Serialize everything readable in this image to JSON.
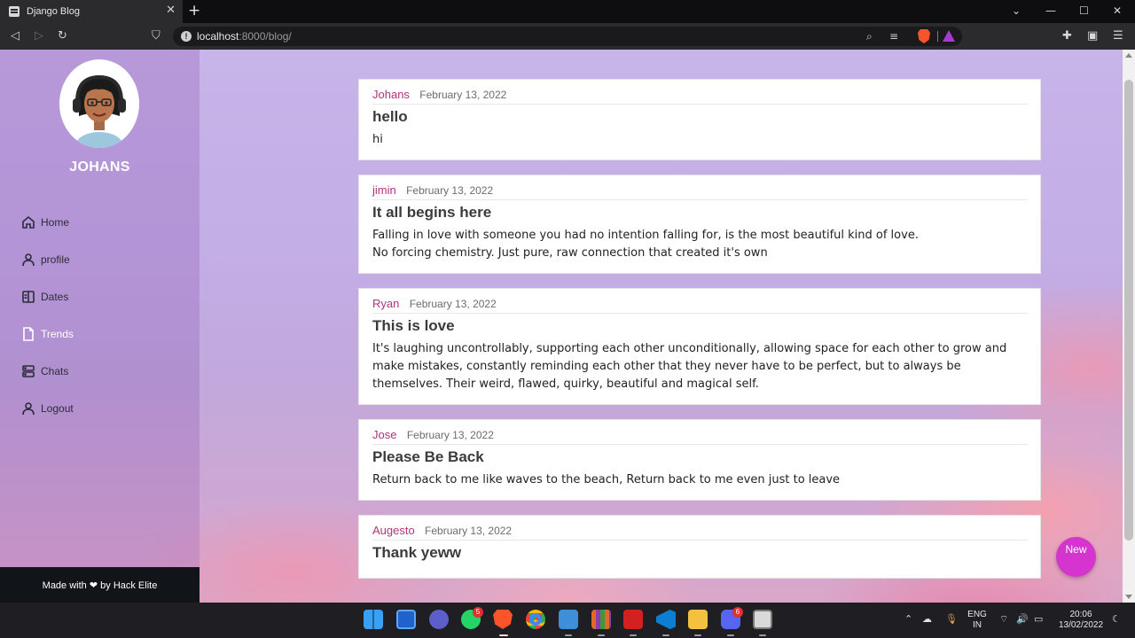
{
  "browser": {
    "tab_title": "Django Blog",
    "url_host": "localhost",
    "url_rest": ":8000/blog/"
  },
  "sidebar": {
    "username": "JOHANS",
    "items": [
      {
        "label": "Home",
        "icon": "home-icon"
      },
      {
        "label": "profile",
        "icon": "user-icon"
      },
      {
        "label": "Dates",
        "icon": "book-icon"
      },
      {
        "label": "Trends",
        "icon": "file-icon",
        "active": true
      },
      {
        "label": "Chats",
        "icon": "server-icon"
      },
      {
        "label": "Logout",
        "icon": "user-icon"
      }
    ],
    "footer_prefix": "Made with",
    "footer_suffix": "by Hack Elite"
  },
  "posts": [
    {
      "author": "Johans",
      "date": "February 13, 2022",
      "title": "hello",
      "body": "hi"
    },
    {
      "author": "jimin",
      "date": "February 13, 2022",
      "title": "It all begins here",
      "body": "Falling in love with someone you had no intention falling for, is the most beautiful kind of love.\nNo forcing chemistry. Just pure, raw connection that created it's own"
    },
    {
      "author": "Ryan",
      "date": "February 13, 2022",
      "title": "This is love",
      "body": "It's laughing uncontrollably, supporting each other unconditionally, allowing space for each other to grow and make mistakes, constantly reminding each other that they never have to be perfect, but to always be themselves. Their weird, flawed, quirky, beautiful and magical self."
    },
    {
      "author": "Jose",
      "date": "February 13, 2022",
      "title": "Please Be Back",
      "body": "Return back to me like waves to the beach, Return back to me even just to leave"
    },
    {
      "author": "Augesto",
      "date": "February 13, 2022",
      "title": "Thank yeww",
      "body": ""
    }
  ],
  "fab_label": "New",
  "taskbar": {
    "whatsapp_badge": "5",
    "discord_badge": "6",
    "lang_top": "ENG",
    "lang_bottom": "IN",
    "time": "20:06",
    "date": "13/02/2022"
  },
  "colors": {
    "author": "#b3327d",
    "fab": "#d634cf",
    "footer_bg": "#111418"
  }
}
